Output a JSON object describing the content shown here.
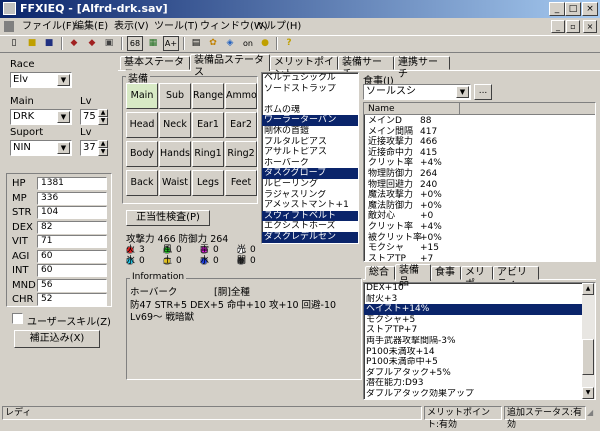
{
  "window": {
    "title": "FFXIEQ - [Alfrd-drk.sav]"
  },
  "menu": [
    "ファイル(F)",
    "編集(E)",
    "表示(V)",
    "ツール(T)",
    "ウィンドウ(W)",
    "ヘルプ(H)"
  ],
  "toolbar": {
    "b68": "68",
    "b_ap": "A+",
    "b_on": "on"
  },
  "left": {
    "race_label": "Race",
    "race_value": "Elv",
    "main_label": "Main",
    "main_value": "DRK",
    "lv_label": "Lv",
    "main_lv": "75",
    "support_label": "Suport",
    "support_value": "NIN",
    "support_lv": "37",
    "stats": [
      {
        "name": "HP",
        "value": "1381"
      },
      {
        "name": "MP",
        "value": "336"
      },
      {
        "name": "STR",
        "value": "104"
      },
      {
        "name": "DEX",
        "value": "82"
      },
      {
        "name": "VIT",
        "value": "71"
      },
      {
        "name": "AGI",
        "value": "60"
      },
      {
        "name": "INT",
        "value": "60"
      },
      {
        "name": "MND",
        "value": "56"
      },
      {
        "name": "CHR",
        "value": "52"
      }
    ],
    "user_skill_label": "ユーザースキル(Z)",
    "correction_button": "補正込み(X)"
  },
  "tabs": [
    "基本ステータス",
    "装備品ステータス",
    "メリットポイント",
    "装備サーチ",
    "連携サーチ"
  ],
  "equip": {
    "group_label": "装備",
    "slots": [
      "Main",
      "Sub",
      "Range",
      "Ammo",
      "Head",
      "Neck",
      "Ear1",
      "Ear2",
      "Body",
      "Hands",
      "Ring1",
      "Ring2",
      "Back",
      "Waist",
      "Legs",
      "Feet"
    ],
    "check_button": "正当性検査(P)",
    "attack_line": "攻撃力 466 防御力 264",
    "elements_row1": [
      {
        "sym": "火",
        "val": "3",
        "color": "#e02020"
      },
      {
        "sym": "風",
        "val": "0",
        "color": "#20c020"
      },
      {
        "sym": "雷",
        "val": "0",
        "color": "#e020e0"
      },
      {
        "sym": "光",
        "val": "0",
        "color": "#ffffff"
      }
    ],
    "elements_row2": [
      {
        "sym": "氷",
        "val": "0",
        "color": "#20c0e0"
      },
      {
        "sym": "土",
        "val": "0",
        "color": "#e0c020"
      },
      {
        "sym": "水",
        "val": "0",
        "color": "#2040e0"
      },
      {
        "sym": "闇",
        "val": "0",
        "color": "#404040"
      }
    ]
  },
  "equip_list": [
    {
      "text": "ベルデュシックル",
      "sel": false
    },
    {
      "text": "ソードストラップ",
      "sel": false
    },
    {
      "text": "",
      "sel": false
    },
    {
      "text": "ボムの魂",
      "sel": false
    },
    {
      "text": "ワーラーターバン",
      "sel": true
    },
    {
      "text": "剛休の首鎧",
      "sel": false
    },
    {
      "text": "ブルタルピアス",
      "sel": false
    },
    {
      "text": "アサルトピアス",
      "sel": false
    },
    {
      "text": "ホーバーク",
      "sel": false
    },
    {
      "text": "タスクグローブ",
      "sel": true
    },
    {
      "text": "ルビーリング",
      "sel": false
    },
    {
      "text": "ラジャスリング",
      "sel": false
    },
    {
      "text": "アメッストマント+1",
      "sel": false
    },
    {
      "text": "スウィフトベルト",
      "sel": true
    },
    {
      "text": "エクシストホーズ",
      "sel": false
    },
    {
      "text": "ダスクレデルセン",
      "sel": true
    }
  ],
  "info": {
    "label": "Information",
    "name": "ホーバーク",
    "type": "[胴]全種",
    "stats": "防47 STR+5 DEX+5 命中+10 攻+10 回避-10",
    "req": "Lv69～ 戦暗獣"
  },
  "food": {
    "label": "食事(J)",
    "value": "ソールスシ",
    "more_button": "..."
  },
  "stat_table": {
    "header": "Name",
    "rows": [
      {
        "name": "メインD",
        "value": "88"
      },
      {
        "name": "メイン間隔",
        "value": "417"
      },
      {
        "name": "近接攻撃力",
        "value": "466"
      },
      {
        "name": "近接命中力",
        "value": "415"
      },
      {
        "name": "クリット率",
        "value": "+4%"
      },
      {
        "name": "物理防御力",
        "value": "264"
      },
      {
        "name": "物理回避力",
        "value": "240"
      },
      {
        "name": "魔法攻撃力",
        "value": "+0%"
      },
      {
        "name": "魔法防御力",
        "value": "+0%"
      },
      {
        "name": "敵対心",
        "value": "+0"
      },
      {
        "name": "クリット率",
        "value": "+4%"
      },
      {
        "name": "被クリット率",
        "value": "+0%"
      },
      {
        "name": "モクシャ",
        "value": "+15"
      },
      {
        "name": "ストアTP",
        "value": "+7"
      }
    ]
  },
  "bottom_tabs": [
    "総合",
    "装備品",
    "食事",
    "メリポ",
    "アビリティ"
  ],
  "effects": [
    {
      "text": "DEX+10",
      "sel": false
    },
    {
      "text": "耐火+3",
      "sel": false
    },
    {
      "text": "ヘイスト+14%",
      "sel": true
    },
    {
      "text": "モクシャ+5",
      "sel": false
    },
    {
      "text": "ストアTP+7",
      "sel": false
    },
    {
      "text": "両手武器攻撃間隔-3%",
      "sel": false
    },
    {
      "text": "P100未満攻+14",
      "sel": false
    },
    {
      "text": "P100未満命中+5",
      "sel": false
    },
    {
      "text": "ダブルアタック+5%",
      "sel": false
    },
    {
      "text": "潜在能力:D93",
      "sel": false
    },
    {
      "text": "ダブルアタック効果アップ",
      "sel": false
    },
    {
      "text": "移動速度ダウン",
      "sel": false
    }
  ],
  "status": {
    "left": "レディ",
    "merit": "メリットポイント:有効",
    "additional": "追加ステータス:有効"
  }
}
